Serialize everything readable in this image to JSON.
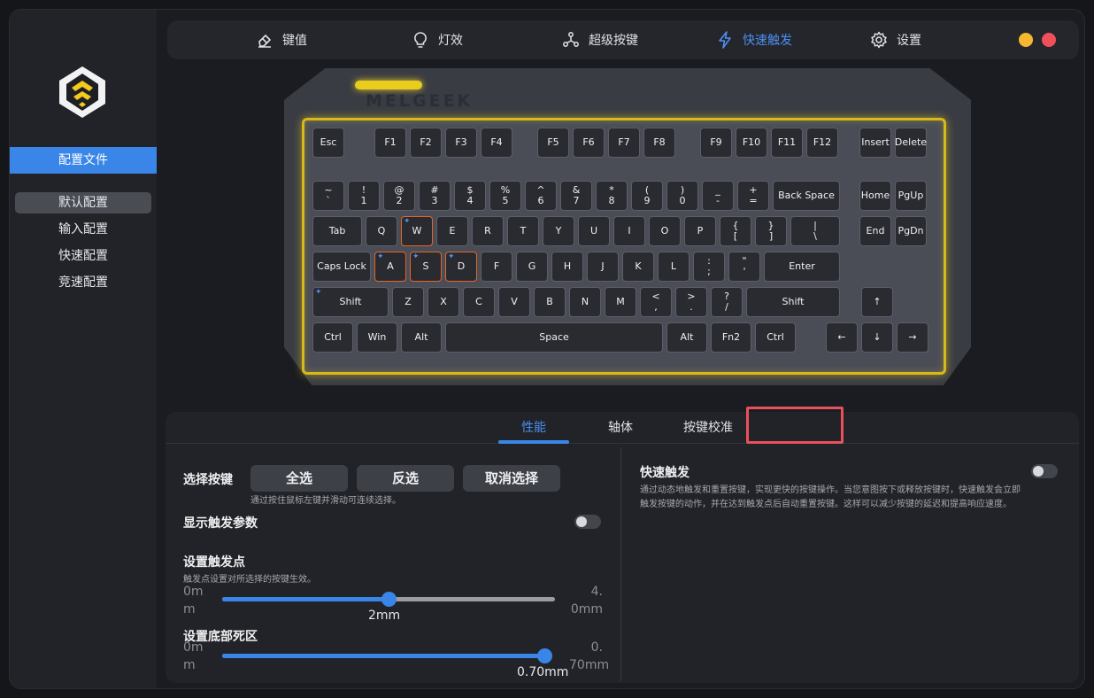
{
  "sidebar": {
    "header": "配置文件",
    "items": [
      {
        "label": "默认配置",
        "active": true
      },
      {
        "label": "输入配置"
      },
      {
        "label": "快速配置"
      },
      {
        "label": "竞速配置"
      }
    ]
  },
  "nav": {
    "items": [
      {
        "label": "键值",
        "icon": "eraser-icon"
      },
      {
        "label": "灯效",
        "icon": "bulb-icon"
      },
      {
        "label": "超级按键",
        "icon": "nodes-icon"
      },
      {
        "label": "快速触发",
        "icon": "lightning-icon",
        "active": true
      },
      {
        "label": "设置",
        "icon": "gear-icon"
      }
    ],
    "colors": {
      "minimize": "#f5b82e",
      "close": "#f0505a",
      "accent": "#3a86e8"
    }
  },
  "keyboard": {
    "brand": "MELGEEK",
    "accent_color": "#d8b81a",
    "highlight_color": "#e0662a",
    "keys": {
      "esc": [
        "Esc"
      ],
      "f1": [
        "F1"
      ],
      "f2": [
        "F2"
      ],
      "f3": [
        "F3"
      ],
      "f4": [
        "F4"
      ],
      "f5": [
        "F5"
      ],
      "f6": [
        "F6"
      ],
      "f7": [
        "F7"
      ],
      "f8": [
        "F8"
      ],
      "f9": [
        "F9"
      ],
      "f10": [
        "F10"
      ],
      "f11": [
        "F11"
      ],
      "f12": [
        "F12"
      ],
      "insert": [
        "Insert"
      ],
      "delete": [
        "Delete"
      ],
      "grave": [
        "~",
        "`"
      ],
      "1": [
        "!",
        "1"
      ],
      "2": [
        "@",
        "2"
      ],
      "3": [
        "#",
        "3"
      ],
      "4": [
        "$",
        "4"
      ],
      "5": [
        "%",
        "5"
      ],
      "6": [
        "^",
        "6"
      ],
      "7": [
        "&",
        "7"
      ],
      "8": [
        "*",
        "8"
      ],
      "9": [
        "(",
        "9"
      ],
      "0": [
        ")",
        "0"
      ],
      "minus": [
        "_",
        "-"
      ],
      "equal": [
        "+",
        "="
      ],
      "backspace": [
        "Back Space"
      ],
      "home": [
        "Home"
      ],
      "pgup": [
        "PgUp"
      ],
      "tab": [
        "Tab"
      ],
      "q": [
        "Q"
      ],
      "w": [
        "W"
      ],
      "e": [
        "E"
      ],
      "r": [
        "R"
      ],
      "t": [
        "T"
      ],
      "y": [
        "Y"
      ],
      "u": [
        "U"
      ],
      "i": [
        "I"
      ],
      "o": [
        "O"
      ],
      "p": [
        "P"
      ],
      "lbracket": [
        "{",
        "["
      ],
      "rbracket": [
        "}",
        "]"
      ],
      "backslash": [
        "|",
        "\\"
      ],
      "end": [
        "End"
      ],
      "pgdn": [
        "PgDn"
      ],
      "caps": [
        "Caps Lock"
      ],
      "a": [
        "A"
      ],
      "s": [
        "S"
      ],
      "d": [
        "D"
      ],
      "f": [
        "F"
      ],
      "g": [
        "G"
      ],
      "h": [
        "H"
      ],
      "j": [
        "J"
      ],
      "k": [
        "K"
      ],
      "l": [
        "L"
      ],
      "semicolon": [
        ":",
        ";"
      ],
      "quote": [
        "\"",
        "'"
      ],
      "enter": [
        "Enter"
      ],
      "lshift": [
        "Shift"
      ],
      "z": [
        "Z"
      ],
      "x": [
        "X"
      ],
      "c": [
        "C"
      ],
      "v": [
        "V"
      ],
      "b": [
        "B"
      ],
      "n": [
        "N"
      ],
      "m": [
        "M"
      ],
      "comma": [
        "<",
        ","
      ],
      "period": [
        ">",
        "."
      ],
      "slash": [
        "?",
        "/"
      ],
      "rshift": [
        "Shift"
      ],
      "up": [
        "↑"
      ],
      "lctrl": [
        "Ctrl"
      ],
      "win": [
        "Win"
      ],
      "lalt": [
        "Alt"
      ],
      "space": [
        "Space"
      ],
      "ralt": [
        "Alt"
      ],
      "fn2": [
        "Fn2"
      ],
      "rctrl": [
        "Ctrl"
      ],
      "left": [
        "←"
      ],
      "down": [
        "↓"
      ],
      "right": [
        "→"
      ]
    },
    "rapid_trigger_keys": [
      "w",
      "a",
      "s",
      "d",
      "lshift"
    ],
    "highlighted_keys": [
      "w",
      "a",
      "s",
      "d"
    ]
  },
  "panel": {
    "tabs": [
      "性能",
      "轴体",
      "按键校准"
    ],
    "select_keys": {
      "label": "选择按键",
      "buttons": [
        "全选",
        "反选",
        "取消选择"
      ],
      "hint": "通过按住鼠标左键并滑动可连续选择。"
    },
    "show_params": {
      "label": "显示触发参数",
      "enabled": false
    },
    "trigger_point": {
      "label": "设置触发点",
      "hint": "触发点设置对所选择的按键生效。",
      "min": [
        "0m",
        "m"
      ],
      "max": [
        "4.",
        "0mm"
      ],
      "value_label": "2mm",
      "value": 2.0,
      "range": [
        0,
        4.0
      ],
      "unit": "mm"
    },
    "deadzone": {
      "label": "设置底部死区",
      "min": [
        "0m",
        "m"
      ],
      "max": [
        "0.",
        "70mm"
      ],
      "value_label": "0.70mm",
      "value": 0.7,
      "range": [
        0,
        0.7
      ],
      "unit": "mm"
    },
    "rapid_trigger": {
      "label": "快速触发",
      "enabled": false,
      "desc_lines": [
        "通过动态地触发和重置按键，实现更快的按键操作。当您意图按下或释放按键时，快速触发会立即",
        "触发按键的动作，并在达到触发点后自动重置按键。这样可以减少按键的延迟和提高响应速度。"
      ]
    }
  }
}
